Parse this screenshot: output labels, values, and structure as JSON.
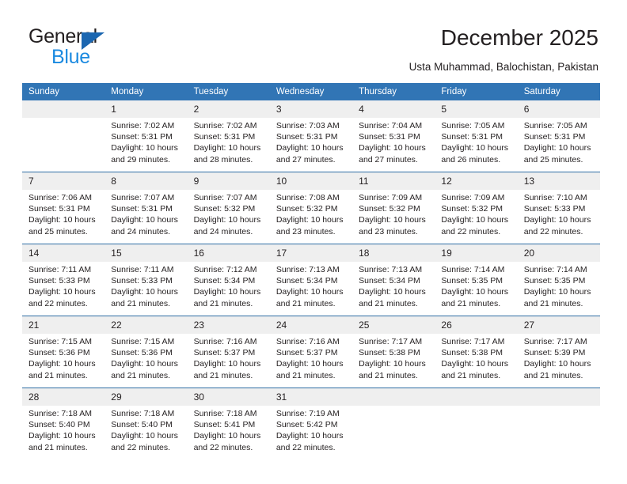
{
  "brand": {
    "name_top": "General",
    "name_bottom": "Blue",
    "accent_dark": "#1b66b0",
    "accent_light": "#1b8ae0"
  },
  "header": {
    "title": "December 2025",
    "location": "Usta Muhammad, Balochistan, Pakistan"
  },
  "calendar": {
    "header_bg": "#3175b5",
    "header_text_color": "#ffffff",
    "daynum_bg": "#efefef",
    "weekday_headers": [
      "Sunday",
      "Monday",
      "Tuesday",
      "Wednesday",
      "Thursday",
      "Friday",
      "Saturday"
    ],
    "weeks": [
      [
        {
          "day": "",
          "sunrise": "",
          "sunset": "",
          "daylight_line1": "",
          "daylight_line2": ""
        },
        {
          "day": "1",
          "sunrise": "Sunrise: 7:02 AM",
          "sunset": "Sunset: 5:31 PM",
          "daylight_line1": "Daylight: 10 hours",
          "daylight_line2": "and 29 minutes."
        },
        {
          "day": "2",
          "sunrise": "Sunrise: 7:02 AM",
          "sunset": "Sunset: 5:31 PM",
          "daylight_line1": "Daylight: 10 hours",
          "daylight_line2": "and 28 minutes."
        },
        {
          "day": "3",
          "sunrise": "Sunrise: 7:03 AM",
          "sunset": "Sunset: 5:31 PM",
          "daylight_line1": "Daylight: 10 hours",
          "daylight_line2": "and 27 minutes."
        },
        {
          "day": "4",
          "sunrise": "Sunrise: 7:04 AM",
          "sunset": "Sunset: 5:31 PM",
          "daylight_line1": "Daylight: 10 hours",
          "daylight_line2": "and 27 minutes."
        },
        {
          "day": "5",
          "sunrise": "Sunrise: 7:05 AM",
          "sunset": "Sunset: 5:31 PM",
          "daylight_line1": "Daylight: 10 hours",
          "daylight_line2": "and 26 minutes."
        },
        {
          "day": "6",
          "sunrise": "Sunrise: 7:05 AM",
          "sunset": "Sunset: 5:31 PM",
          "daylight_line1": "Daylight: 10 hours",
          "daylight_line2": "and 25 minutes."
        }
      ],
      [
        {
          "day": "7",
          "sunrise": "Sunrise: 7:06 AM",
          "sunset": "Sunset: 5:31 PM",
          "daylight_line1": "Daylight: 10 hours",
          "daylight_line2": "and 25 minutes."
        },
        {
          "day": "8",
          "sunrise": "Sunrise: 7:07 AM",
          "sunset": "Sunset: 5:31 PM",
          "daylight_line1": "Daylight: 10 hours",
          "daylight_line2": "and 24 minutes."
        },
        {
          "day": "9",
          "sunrise": "Sunrise: 7:07 AM",
          "sunset": "Sunset: 5:32 PM",
          "daylight_line1": "Daylight: 10 hours",
          "daylight_line2": "and 24 minutes."
        },
        {
          "day": "10",
          "sunrise": "Sunrise: 7:08 AM",
          "sunset": "Sunset: 5:32 PM",
          "daylight_line1": "Daylight: 10 hours",
          "daylight_line2": "and 23 minutes."
        },
        {
          "day": "11",
          "sunrise": "Sunrise: 7:09 AM",
          "sunset": "Sunset: 5:32 PM",
          "daylight_line1": "Daylight: 10 hours",
          "daylight_line2": "and 23 minutes."
        },
        {
          "day": "12",
          "sunrise": "Sunrise: 7:09 AM",
          "sunset": "Sunset: 5:32 PM",
          "daylight_line1": "Daylight: 10 hours",
          "daylight_line2": "and 22 minutes."
        },
        {
          "day": "13",
          "sunrise": "Sunrise: 7:10 AM",
          "sunset": "Sunset: 5:33 PM",
          "daylight_line1": "Daylight: 10 hours",
          "daylight_line2": "and 22 minutes."
        }
      ],
      [
        {
          "day": "14",
          "sunrise": "Sunrise: 7:11 AM",
          "sunset": "Sunset: 5:33 PM",
          "daylight_line1": "Daylight: 10 hours",
          "daylight_line2": "and 22 minutes."
        },
        {
          "day": "15",
          "sunrise": "Sunrise: 7:11 AM",
          "sunset": "Sunset: 5:33 PM",
          "daylight_line1": "Daylight: 10 hours",
          "daylight_line2": "and 21 minutes."
        },
        {
          "day": "16",
          "sunrise": "Sunrise: 7:12 AM",
          "sunset": "Sunset: 5:34 PM",
          "daylight_line1": "Daylight: 10 hours",
          "daylight_line2": "and 21 minutes."
        },
        {
          "day": "17",
          "sunrise": "Sunrise: 7:13 AM",
          "sunset": "Sunset: 5:34 PM",
          "daylight_line1": "Daylight: 10 hours",
          "daylight_line2": "and 21 minutes."
        },
        {
          "day": "18",
          "sunrise": "Sunrise: 7:13 AM",
          "sunset": "Sunset: 5:34 PM",
          "daylight_line1": "Daylight: 10 hours",
          "daylight_line2": "and 21 minutes."
        },
        {
          "day": "19",
          "sunrise": "Sunrise: 7:14 AM",
          "sunset": "Sunset: 5:35 PM",
          "daylight_line1": "Daylight: 10 hours",
          "daylight_line2": "and 21 minutes."
        },
        {
          "day": "20",
          "sunrise": "Sunrise: 7:14 AM",
          "sunset": "Sunset: 5:35 PM",
          "daylight_line1": "Daylight: 10 hours",
          "daylight_line2": "and 21 minutes."
        }
      ],
      [
        {
          "day": "21",
          "sunrise": "Sunrise: 7:15 AM",
          "sunset": "Sunset: 5:36 PM",
          "daylight_line1": "Daylight: 10 hours",
          "daylight_line2": "and 21 minutes."
        },
        {
          "day": "22",
          "sunrise": "Sunrise: 7:15 AM",
          "sunset": "Sunset: 5:36 PM",
          "daylight_line1": "Daylight: 10 hours",
          "daylight_line2": "and 21 minutes."
        },
        {
          "day": "23",
          "sunrise": "Sunrise: 7:16 AM",
          "sunset": "Sunset: 5:37 PM",
          "daylight_line1": "Daylight: 10 hours",
          "daylight_line2": "and 21 minutes."
        },
        {
          "day": "24",
          "sunrise": "Sunrise: 7:16 AM",
          "sunset": "Sunset: 5:37 PM",
          "daylight_line1": "Daylight: 10 hours",
          "daylight_line2": "and 21 minutes."
        },
        {
          "day": "25",
          "sunrise": "Sunrise: 7:17 AM",
          "sunset": "Sunset: 5:38 PM",
          "daylight_line1": "Daylight: 10 hours",
          "daylight_line2": "and 21 minutes."
        },
        {
          "day": "26",
          "sunrise": "Sunrise: 7:17 AM",
          "sunset": "Sunset: 5:38 PM",
          "daylight_line1": "Daylight: 10 hours",
          "daylight_line2": "and 21 minutes."
        },
        {
          "day": "27",
          "sunrise": "Sunrise: 7:17 AM",
          "sunset": "Sunset: 5:39 PM",
          "daylight_line1": "Daylight: 10 hours",
          "daylight_line2": "and 21 minutes."
        }
      ],
      [
        {
          "day": "28",
          "sunrise": "Sunrise: 7:18 AM",
          "sunset": "Sunset: 5:40 PM",
          "daylight_line1": "Daylight: 10 hours",
          "daylight_line2": "and 21 minutes."
        },
        {
          "day": "29",
          "sunrise": "Sunrise: 7:18 AM",
          "sunset": "Sunset: 5:40 PM",
          "daylight_line1": "Daylight: 10 hours",
          "daylight_line2": "and 22 minutes."
        },
        {
          "day": "30",
          "sunrise": "Sunrise: 7:18 AM",
          "sunset": "Sunset: 5:41 PM",
          "daylight_line1": "Daylight: 10 hours",
          "daylight_line2": "and 22 minutes."
        },
        {
          "day": "31",
          "sunrise": "Sunrise: 7:19 AM",
          "sunset": "Sunset: 5:42 PM",
          "daylight_line1": "Daylight: 10 hours",
          "daylight_line2": "and 22 minutes."
        },
        {
          "day": "",
          "sunrise": "",
          "sunset": "",
          "daylight_line1": "",
          "daylight_line2": ""
        },
        {
          "day": "",
          "sunrise": "",
          "sunset": "",
          "daylight_line1": "",
          "daylight_line2": ""
        },
        {
          "day": "",
          "sunrise": "",
          "sunset": "",
          "daylight_line1": "",
          "daylight_line2": ""
        }
      ]
    ]
  }
}
